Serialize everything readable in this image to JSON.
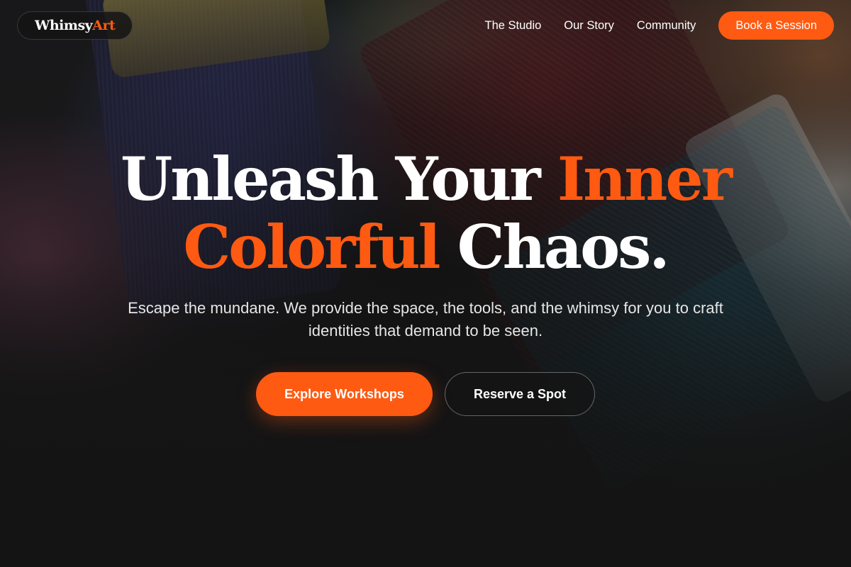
{
  "brand": {
    "name_primary": "Whimsy",
    "name_accent": "Art"
  },
  "nav": {
    "links": [
      "The Studio",
      "Our Story",
      "Community"
    ],
    "cta_label": "Book a Session"
  },
  "hero": {
    "headline_line1_white": "Unleash Your ",
    "headline_line1_accent": "Inner",
    "headline_line2_accent": "Colorful",
    "headline_line2_white": " Chaos.",
    "subtitle": "Escape the mundane. We provide the space, the tools, and the whimsy for you to craft identities that demand to be seen.",
    "primary_button": "Explore Workshops",
    "secondary_button": "Reserve a Spot"
  },
  "colors": {
    "accent": "#ff5a12",
    "background": "#141414",
    "text": "#ffffff"
  }
}
